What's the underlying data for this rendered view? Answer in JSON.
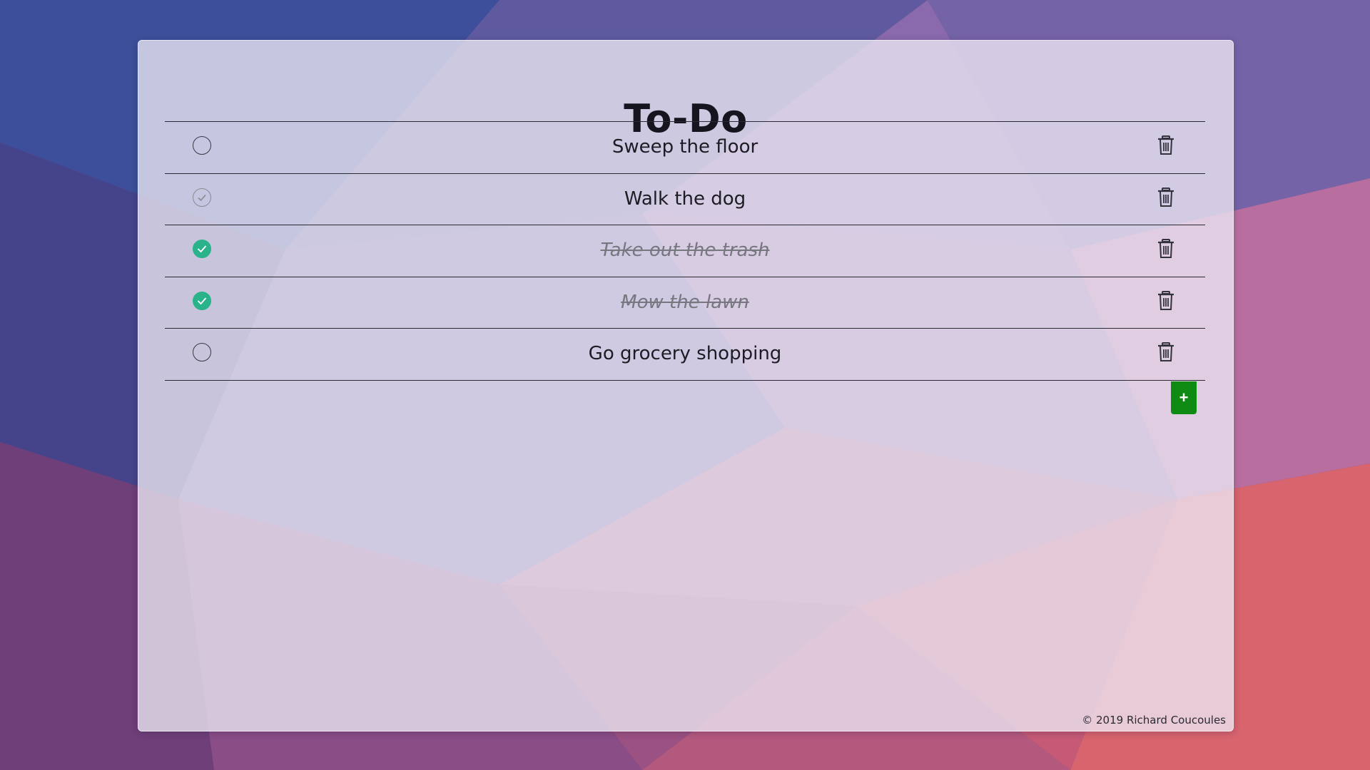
{
  "app": {
    "title": "To-Do",
    "footer": "© 2019 Richard Coucoules"
  },
  "todos": [
    {
      "text": "Sweep the floor",
      "state": "unchecked"
    },
    {
      "text": "Walk the dog",
      "state": "hover"
    },
    {
      "text": "Take out the trash",
      "state": "done"
    },
    {
      "text": "Mow the lawn",
      "state": "done"
    },
    {
      "text": "Go grocery shopping",
      "state": "unchecked"
    }
  ],
  "controls": {
    "add_label": "+"
  },
  "colors": {
    "done_check": "#2ab38a",
    "add_button": "#0f8a12",
    "done_text": "#777780"
  },
  "icons": {
    "delete": "trash-icon",
    "complete": "check-circle-icon",
    "add": "plus-icon"
  }
}
